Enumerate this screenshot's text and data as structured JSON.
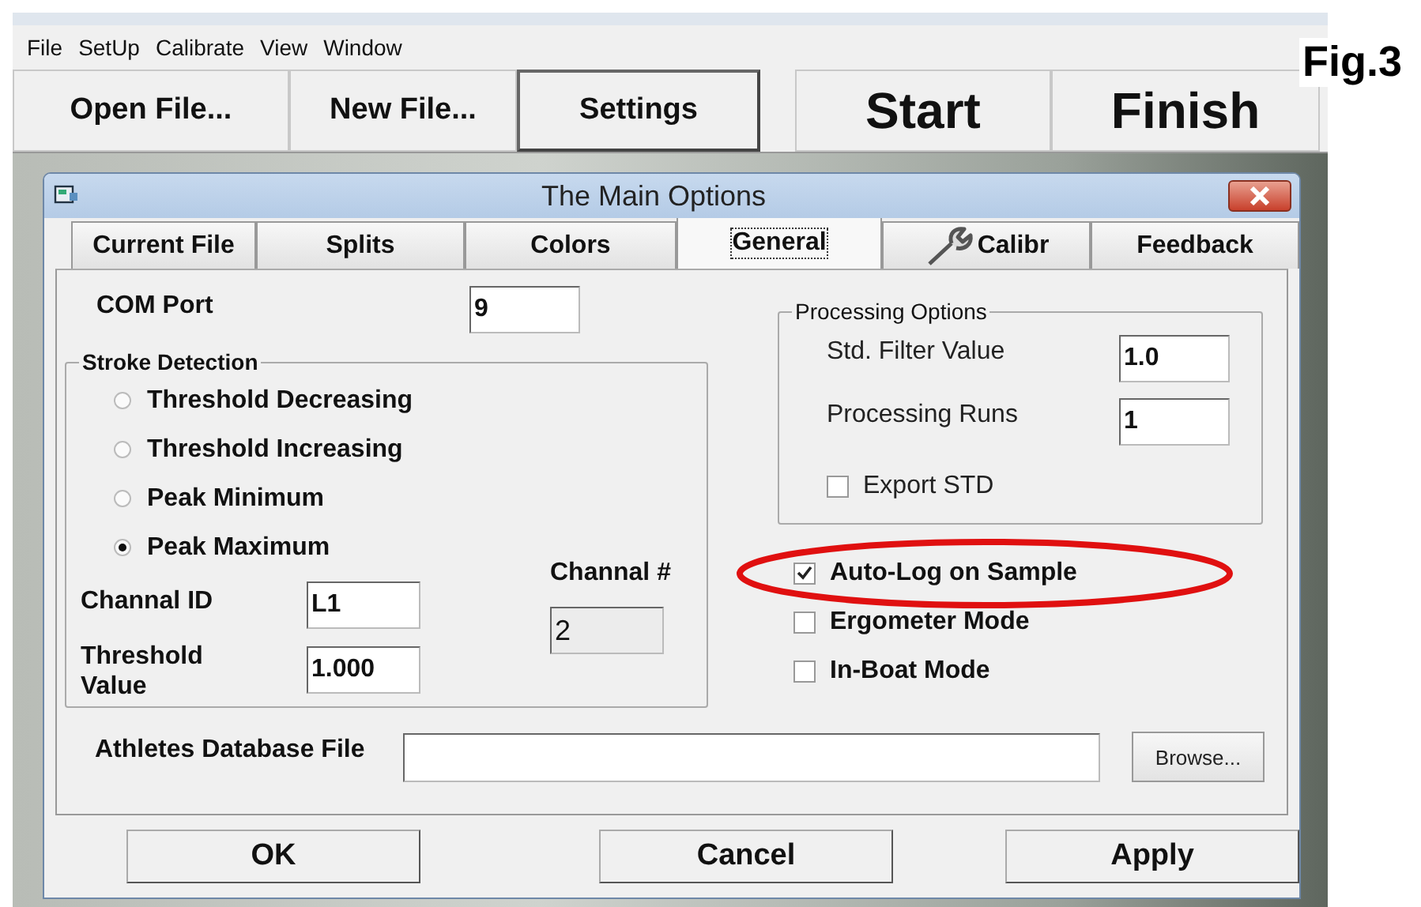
{
  "menu": [
    "File",
    "SetUp",
    "Calibrate",
    "View",
    "Window"
  ],
  "toolbar": [
    {
      "label": "Open File...",
      "kind": "normal",
      "selected": false
    },
    {
      "label": "New File...",
      "kind": "normal",
      "selected": false
    },
    {
      "label": "Settings",
      "kind": "normal",
      "selected": true
    },
    {
      "label": "Start",
      "kind": "large",
      "selected": false
    },
    {
      "label": "Finish",
      "kind": "large",
      "selected": false
    }
  ],
  "figure_label": "Fig.3",
  "dialog": {
    "title": "The Main Options",
    "tabs": [
      {
        "label": "Current File",
        "kind": "text",
        "selected": false
      },
      {
        "label": "Splits",
        "kind": "text",
        "selected": false
      },
      {
        "label": "Colors",
        "kind": "text",
        "selected": false
      },
      {
        "label": "General",
        "kind": "text",
        "selected": true
      },
      {
        "label": "Calibr",
        "kind": "wrench",
        "selected": false
      },
      {
        "label": "Feedback",
        "kind": "text",
        "selected": false
      }
    ],
    "com_port": {
      "label": "COM Port",
      "value": "9"
    },
    "stroke_detection": {
      "title": "Stroke Detection",
      "options": [
        {
          "label": "Threshold Decreasing",
          "selected": false
        },
        {
          "label": "Threshold Increasing",
          "selected": false
        },
        {
          "label": "Peak Minimum",
          "selected": false
        },
        {
          "label": "Peak Maximum",
          "selected": true
        }
      ]
    },
    "channel_id": {
      "label": "Channal ID",
      "value": "L1"
    },
    "threshold": {
      "label": "Threshold Value",
      "value": "1.000"
    },
    "channel_number": {
      "label": "Channal #",
      "value": "2",
      "disabled": true
    },
    "processing": {
      "title": "Processing Options",
      "filter": {
        "label": "Std. Filter Value",
        "value": "1.0"
      },
      "runs": {
        "label": "Processing Runs",
        "value": "1"
      },
      "export_std": {
        "label": "Export STD",
        "checked": false
      }
    },
    "options": [
      {
        "label": "Auto-Log on Sample",
        "checked": true,
        "highlighted": true
      },
      {
        "label": "Ergometer Mode",
        "checked": false,
        "highlighted": false
      },
      {
        "label": "In-Boat Mode",
        "checked": false,
        "highlighted": false
      }
    ],
    "database": {
      "label": "Athletes Database File",
      "browse": "Browse..."
    },
    "buttons": [
      "OK",
      "Cancel",
      "Apply"
    ]
  }
}
